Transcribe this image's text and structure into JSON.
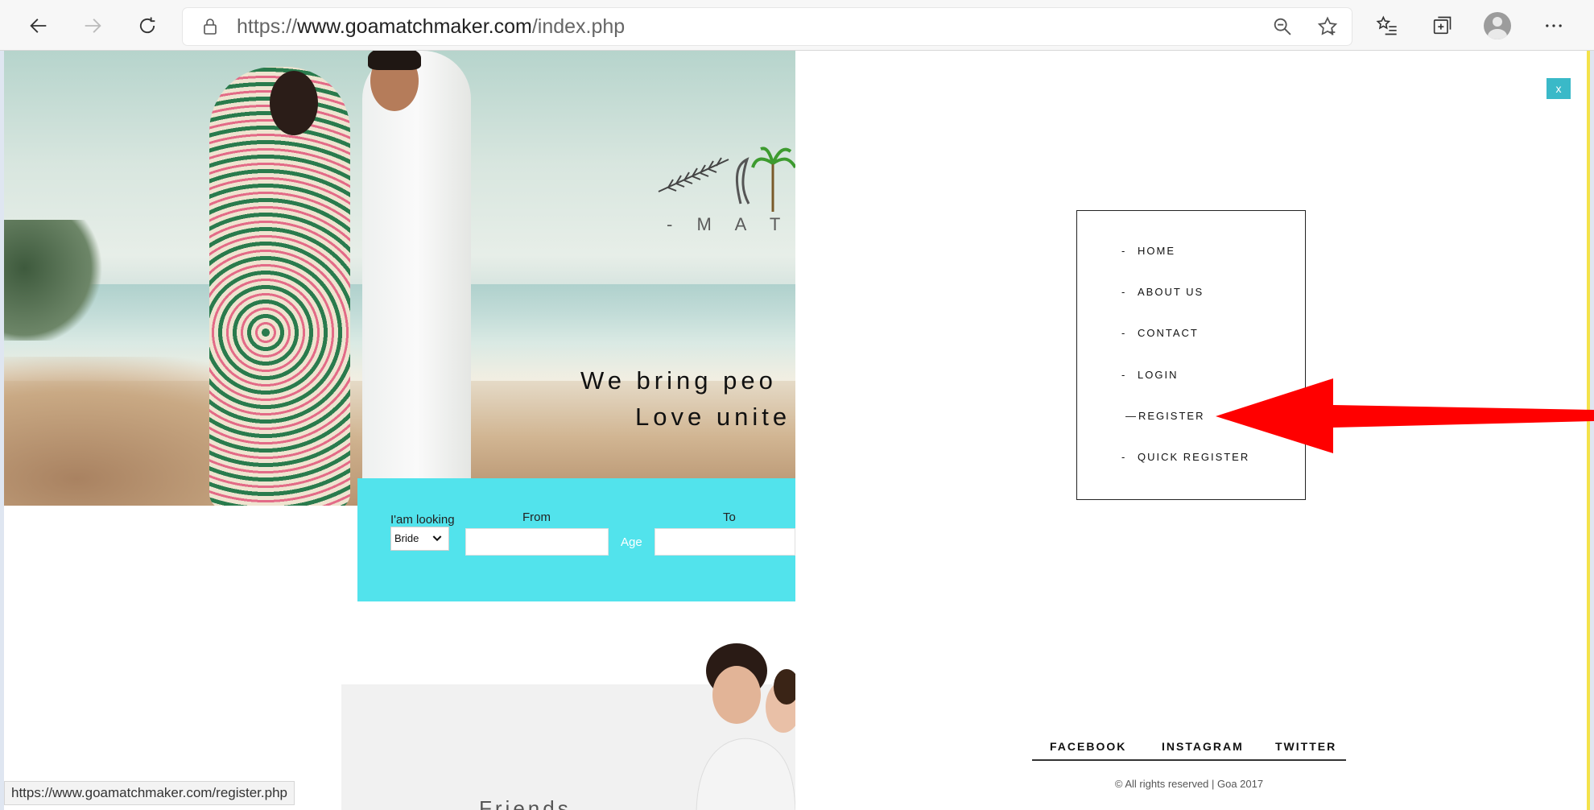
{
  "browser": {
    "url_scheme": "https://",
    "url_host": "www.goamatchmaker.com",
    "url_path": "/index.php",
    "status_url": "https://www.goamatchmaker.com/register.php"
  },
  "hero": {
    "logo_sub": "- M A T C H",
    "tagline_line1": "We bring peo",
    "tagline_line2": "Love unite",
    "search": {
      "looking_label": "I'am looking",
      "looking_value": "Bride",
      "from_label": "From",
      "to_label": "To",
      "age_label": "Age"
    },
    "cut_text": "Friends ..."
  },
  "menu": {
    "close_label": "x",
    "items": [
      {
        "dash": "-",
        "label": "HOME"
      },
      {
        "dash": "-",
        "label": "ABOUT US"
      },
      {
        "dash": "-",
        "label": "CONTACT"
      },
      {
        "dash": "-",
        "label": "LOGIN"
      },
      {
        "dash": "—",
        "label": "REGISTER"
      },
      {
        "dash": "-",
        "label": "QUICK REGISTER"
      }
    ]
  },
  "footer": {
    "facebook": "FACEBOOK",
    "instagram": "INSTAGRAM",
    "twitter": "TWITTER",
    "copyright": "© All rights reserved | Goa 2017"
  },
  "colors": {
    "accent_cyan": "#52e3ec",
    "close_teal": "#3ab9c8",
    "arrow_red": "#ff0000"
  }
}
